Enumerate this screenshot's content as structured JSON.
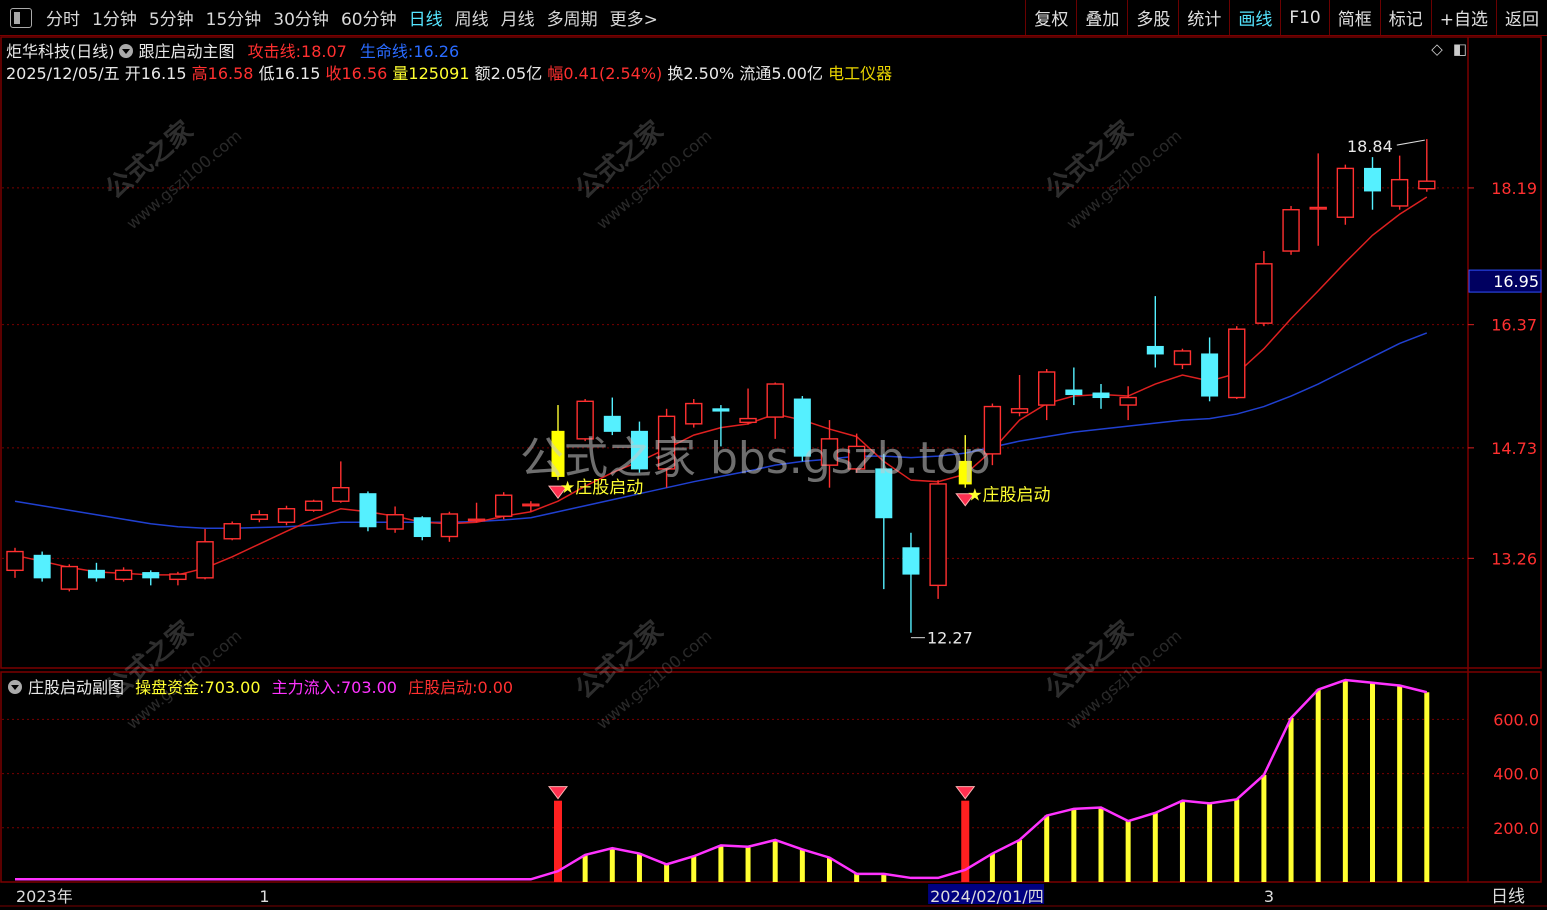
{
  "toolbar": {
    "periods": [
      "分时",
      "1分钟",
      "5分钟",
      "15分钟",
      "30分钟",
      "60分钟",
      "日线",
      "周线",
      "月线",
      "多周期",
      "更多>"
    ],
    "active_period": "日线",
    "buttons": [
      "复权",
      "叠加",
      "多股",
      "统计",
      "画线",
      "F10",
      "简框",
      "标记",
      "+自选",
      "返回"
    ],
    "active_button": "画线"
  },
  "header": {
    "stock_name": "炬华科技(日线)",
    "indicator_name": "跟庄启动主图",
    "attack_label": "攻击线:",
    "attack_value": "18.07",
    "life_label": "生命线:",
    "life_value": "16.26"
  },
  "quote": {
    "date": "2025/12/05/五",
    "open_label": "开",
    "open": "16.15",
    "high_label": "高",
    "high": "16.58",
    "low_label": "低",
    "low": "16.15",
    "close_label": "收",
    "close": "16.56",
    "vol_label": "量",
    "vol": "125091",
    "amount_label": "额",
    "amount": "2.05亿",
    "change_label": "幅",
    "change": "0.41(2.54%)",
    "turnover_label": "换",
    "turnover": "2.50%",
    "float_label": "流通",
    "float": "5.00亿",
    "sector": "电工仪器"
  },
  "sub_header": {
    "name": "庄股启动副图",
    "cap_label": "操盘资金:",
    "cap_value": "703.00",
    "flow_label": "主力流入:",
    "flow_value": "703.00",
    "start_label": "庄股启动:",
    "start_value": "0.00"
  },
  "watermarks": {
    "logo": "公式之家",
    "site": "www.gszj100.com",
    "center": "公式之家 bbs.gszb.top"
  },
  "colors": {
    "up": "#ff3030",
    "down": "#55f0ff",
    "attack_line": "#dd2020",
    "life_line": "#2040d0",
    "bar": "#ffff30",
    "flow_line": "#ff33ff",
    "grid": "#7a0000"
  },
  "chart_data": {
    "type": "candlestick",
    "price_axis": {
      "ticks": [
        13.26,
        14.73,
        16.37,
        18.19
      ],
      "current_price": 16.95,
      "ylim": [
        11.8,
        19.6
      ]
    },
    "max_label": "18.84",
    "min_label": "12.27",
    "signal_text": "★庄股启动",
    "candles": [
      {
        "o": 13.1,
        "c": 13.35,
        "h": 13.4,
        "l": 13.0
      },
      {
        "o": 13.3,
        "c": 13.0,
        "h": 13.35,
        "l": 12.95
      },
      {
        "o": 12.85,
        "c": 13.15,
        "h": 13.18,
        "l": 12.82
      },
      {
        "o": 13.1,
        "c": 13.0,
        "h": 13.2,
        "l": 12.95
      },
      {
        "o": 12.98,
        "c": 13.1,
        "h": 13.14,
        "l": 12.95
      },
      {
        "o": 13.07,
        "c": 13.0,
        "h": 13.1,
        "l": 12.9
      },
      {
        "o": 12.98,
        "c": 13.05,
        "h": 13.08,
        "l": 12.9
      },
      {
        "o": 13.0,
        "c": 13.48,
        "h": 13.65,
        "l": 12.98
      },
      {
        "o": 13.52,
        "c": 13.72,
        "h": 13.75,
        "l": 13.5
      },
      {
        "o": 13.78,
        "c": 13.84,
        "h": 13.9,
        "l": 13.74
      },
      {
        "o": 13.74,
        "c": 13.92,
        "h": 13.96,
        "l": 13.7
      },
      {
        "o": 13.9,
        "c": 14.02,
        "h": 14.04,
        "l": 13.88
      },
      {
        "o": 14.02,
        "c": 14.2,
        "h": 14.55,
        "l": 14.0
      },
      {
        "o": 14.12,
        "c": 13.68,
        "h": 14.15,
        "l": 13.62
      },
      {
        "o": 13.65,
        "c": 13.84,
        "h": 13.95,
        "l": 13.6
      },
      {
        "o": 13.8,
        "c": 13.55,
        "h": 13.82,
        "l": 13.5
      },
      {
        "o": 13.55,
        "c": 13.85,
        "h": 13.88,
        "l": 13.48
      },
      {
        "o": 13.78,
        "c": 13.78,
        "h": 14.0,
        "l": 13.74
      },
      {
        "o": 13.82,
        "c": 14.1,
        "h": 14.14,
        "l": 13.78
      },
      {
        "o": 13.96,
        "c": 13.98,
        "h": 14.02,
        "l": 13.88
      },
      {
        "o": 14.35,
        "c": 14.95,
        "h": 15.3,
        "l": 14.3
      },
      {
        "o": 14.85,
        "c": 15.35,
        "h": 15.38,
        "l": 14.82
      },
      {
        "o": 15.15,
        "c": 14.95,
        "h": 15.4,
        "l": 14.9
      },
      {
        "o": 14.95,
        "c": 14.45,
        "h": 15.08,
        "l": 14.4
      },
      {
        "o": 14.45,
        "c": 15.15,
        "h": 15.25,
        "l": 14.2
      },
      {
        "o": 15.05,
        "c": 15.32,
        "h": 15.38,
        "l": 15.0
      },
      {
        "o": 15.25,
        "c": 15.22,
        "h": 15.3,
        "l": 14.75
      },
      {
        "o": 15.07,
        "c": 15.12,
        "h": 15.52,
        "l": 15.04
      },
      {
        "o": 15.14,
        "c": 15.58,
        "h": 15.6,
        "l": 14.85
      },
      {
        "o": 15.38,
        "c": 14.62,
        "h": 15.42,
        "l": 14.55
      },
      {
        "o": 14.5,
        "c": 14.85,
        "h": 15.1,
        "l": 14.2
      },
      {
        "o": 14.45,
        "c": 14.75,
        "h": 14.92,
        "l": 14.4
      },
      {
        "o": 14.45,
        "c": 13.8,
        "h": 14.65,
        "l": 12.85
      },
      {
        "o": 13.4,
        "c": 13.05,
        "h": 13.6,
        "l": 12.27
      },
      {
        "o": 12.9,
        "c": 14.25,
        "h": 14.3,
        "l": 12.72
      },
      {
        "o": 14.25,
        "c": 14.55,
        "h": 14.9,
        "l": 14.2
      },
      {
        "o": 14.65,
        "c": 15.28,
        "h": 15.32,
        "l": 14.5
      },
      {
        "o": 15.2,
        "c": 15.25,
        "h": 15.7,
        "l": 15.15
      },
      {
        "o": 15.3,
        "c": 15.74,
        "h": 15.78,
        "l": 15.1
      },
      {
        "o": 15.5,
        "c": 15.44,
        "h": 15.8,
        "l": 15.3
      },
      {
        "o": 15.46,
        "c": 15.4,
        "h": 15.58,
        "l": 15.25
      },
      {
        "o": 15.3,
        "c": 15.4,
        "h": 15.55,
        "l": 15.1
      },
      {
        "o": 16.08,
        "c": 15.98,
        "h": 16.75,
        "l": 15.8
      },
      {
        "o": 15.84,
        "c": 16.02,
        "h": 16.05,
        "l": 15.78
      },
      {
        "o": 15.98,
        "c": 15.42,
        "h": 16.2,
        "l": 15.35
      },
      {
        "o": 15.4,
        "c": 16.31,
        "h": 16.35,
        "l": 15.38
      },
      {
        "o": 16.39,
        "c": 17.18,
        "h": 17.35,
        "l": 16.35
      },
      {
        "o": 17.35,
        "c": 17.9,
        "h": 17.95,
        "l": 17.3
      },
      {
        "o": 17.92,
        "c": 17.93,
        "h": 18.65,
        "l": 17.42
      },
      {
        "o": 17.8,
        "c": 18.45,
        "h": 18.5,
        "l": 17.7
      },
      {
        "o": 18.45,
        "c": 18.15,
        "h": 18.6,
        "l": 17.9
      },
      {
        "o": 17.95,
        "c": 18.3,
        "h": 18.62,
        "l": 17.9
      },
      {
        "o": 18.18,
        "c": 18.28,
        "h": 18.84,
        "l": 18.14
      }
    ],
    "attack_line": [
      13.3,
      13.22,
      13.14,
      13.08,
      13.06,
      13.04,
      13.04,
      13.13,
      13.28,
      13.45,
      13.62,
      13.78,
      13.92,
      13.88,
      13.82,
      13.74,
      13.72,
      13.74,
      13.82,
      13.88,
      14.02,
      14.22,
      14.4,
      14.55,
      14.72,
      14.9,
      15.0,
      15.05,
      15.18,
      15.1,
      14.98,
      14.88,
      14.55,
      14.3,
      14.28,
      14.38,
      14.7,
      15.1,
      15.32,
      15.42,
      15.44,
      15.42,
      15.58,
      15.7,
      15.62,
      15.72,
      16.05,
      16.45,
      16.82,
      17.2,
      17.56,
      17.84,
      18.07
    ],
    "life_line": [
      14.02,
      13.96,
      13.9,
      13.84,
      13.78,
      13.72,
      13.68,
      13.66,
      13.66,
      13.67,
      13.68,
      13.7,
      13.74,
      13.74,
      13.74,
      13.74,
      13.74,
      13.75,
      13.77,
      13.8,
      13.88,
      13.96,
      14.04,
      14.12,
      14.2,
      14.28,
      14.35,
      14.42,
      14.5,
      14.55,
      14.58,
      14.62,
      14.62,
      14.6,
      14.62,
      14.66,
      14.74,
      14.82,
      14.88,
      14.94,
      14.98,
      15.02,
      15.06,
      15.1,
      15.12,
      15.18,
      15.28,
      15.42,
      15.58,
      15.76,
      15.94,
      16.12,
      16.26
    ],
    "signals": [
      20,
      35
    ],
    "sub_axis": {
      "ticks": [
        200.0,
        400.0,
        600.0
      ],
      "ylim": [
        0,
        760
      ]
    },
    "funds": [
      10,
      10,
      10,
      10,
      10,
      10,
      10,
      10,
      10,
      10,
      10,
      10,
      10,
      10,
      10,
      10,
      10,
      10,
      10,
      10,
      40,
      100,
      125,
      105,
      65,
      95,
      135,
      130,
      155,
      120,
      90,
      30,
      30,
      15,
      15,
      45,
      105,
      155,
      245,
      270,
      275,
      225,
      255,
      300,
      290,
      305,
      395,
      605,
      710,
      745,
      735,
      725,
      700
    ],
    "x_labels": [
      {
        "index": 0,
        "text": "2023年"
      },
      {
        "index": 9,
        "text": "1"
      },
      {
        "index": 34,
        "text": "2024/02/01/四"
      },
      {
        "index": 46,
        "text": "3"
      }
    ],
    "period_label": "日线"
  }
}
